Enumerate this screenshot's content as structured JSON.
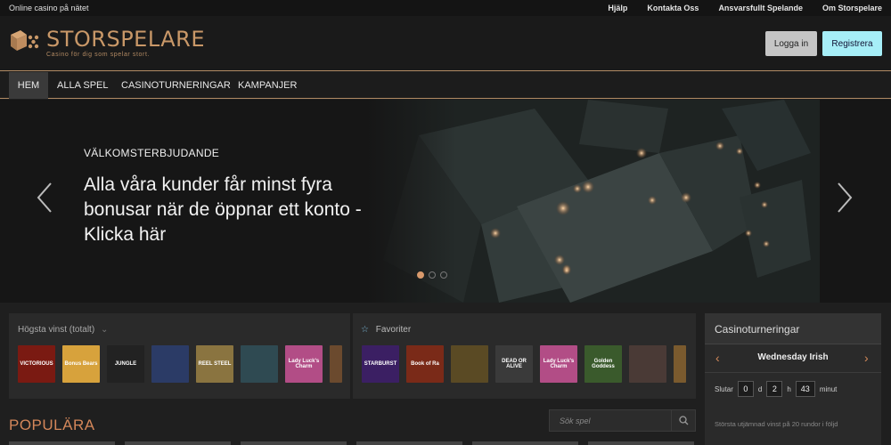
{
  "topbar": {
    "tagline": "Online casino på nätet",
    "links": [
      "Hjälp",
      "Kontakta Oss",
      "Ansvarsfullt Spelande",
      "Om Storspelare"
    ]
  },
  "header": {
    "logo_name": "STORSPELARE",
    "logo_tagline": "Casino för dig som spelar stort.",
    "login_label": "Logga in",
    "register_label": "Registrera",
    "colors": {
      "brand": "#c99868",
      "register_bg": "#a6eef7",
      "login_bg": "#c5c5c5"
    }
  },
  "nav": {
    "items": [
      {
        "label": "HEM",
        "active": true
      },
      {
        "label": "ALLA SPEL",
        "active": false
      },
      {
        "label": "CASINOTURNERINGAR",
        "active": false
      },
      {
        "label": "KAMPANJER",
        "active": false
      }
    ]
  },
  "hero": {
    "kicker": "VÄLKOMSTERBJUDANDE",
    "title": "Alla våra kunder får minst fyra bonusar när de öppnar ett konto - Klicka här",
    "prev_icon": "chevron-left-icon",
    "next_icon": "chevron-right-icon",
    "slides_count": 3,
    "active_slide": 1
  },
  "panels": {
    "top_wins": {
      "title": "Högsta vinst (totalt)",
      "icon": "chevron-down-icon",
      "games": [
        {
          "label": "VICTORIOUS",
          "color": "#7a1a12"
        },
        {
          "label": "Bonus Bears",
          "color": "#d7a23c"
        },
        {
          "label": "JUNGLE",
          "color": "#222222"
        },
        {
          "label": "",
          "color": "#2b3b66"
        },
        {
          "label": "REEL STEEL",
          "color": "#8a7440"
        },
        {
          "label": "",
          "color": "#2f4a52"
        },
        {
          "label": "Lady Luck's Charm",
          "color": "#b24d86"
        },
        {
          "label": "",
          "color": "#6b4a2e"
        }
      ]
    },
    "favorites": {
      "title": "Favoriter",
      "icon": "star-icon",
      "games": [
        {
          "label": "STARBURST",
          "color": "#3b1f63"
        },
        {
          "label": "Book of Ra",
          "color": "#7a2a18"
        },
        {
          "label": "",
          "color": "#5a4a24"
        },
        {
          "label": "DEAD OR ALIVE",
          "color": "#3a3a3a"
        },
        {
          "label": "Lady Luck's Charm",
          "color": "#b24d86"
        },
        {
          "label": "Golden Goddess",
          "color": "#3a5a2c"
        },
        {
          "label": "",
          "color": "#4a3a36"
        },
        {
          "label": "",
          "color": "#7a5a2e"
        }
      ]
    }
  },
  "tournament": {
    "title": "Casinoturneringar",
    "name": "Wednesday Irish",
    "ends_label": "Slutar",
    "days": "0",
    "days_unit": "d",
    "hours": "2",
    "hours_unit": "h",
    "minutes": "43",
    "minutes_unit": "minut",
    "description": "Största utjämnad vinst på 20 rundor i följd"
  },
  "popular": {
    "title": "POPULÄRA"
  },
  "search": {
    "placeholder": "Sök spel",
    "icon": "search-icon"
  }
}
